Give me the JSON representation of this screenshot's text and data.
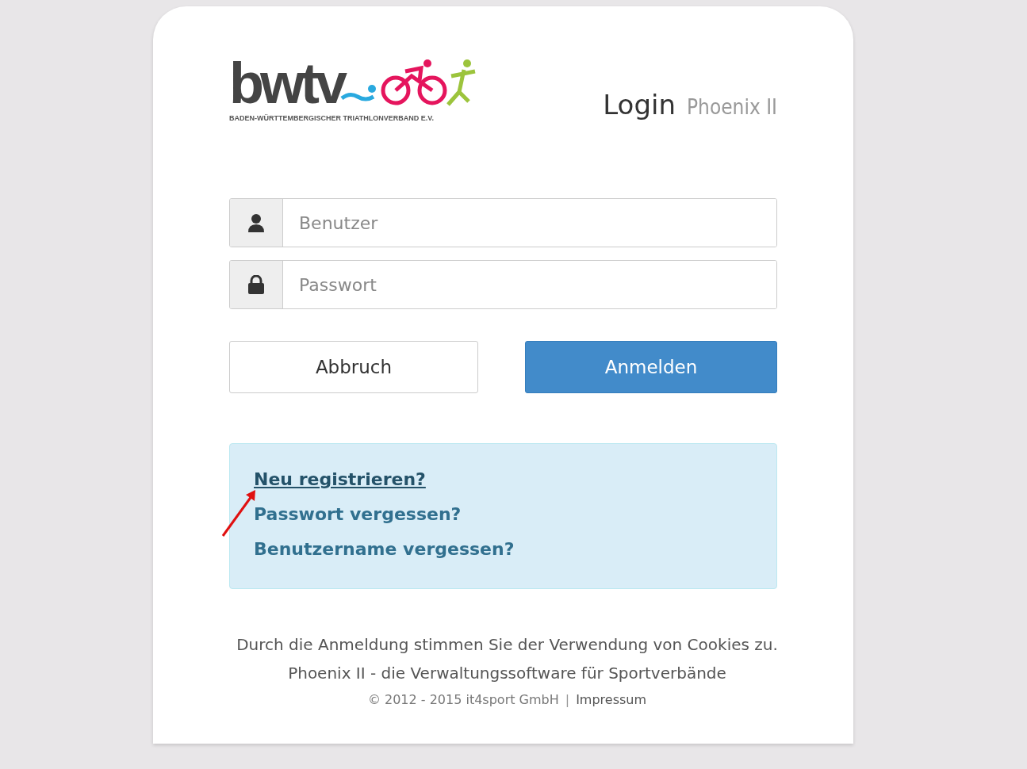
{
  "logo": {
    "wordmark": "bwtv",
    "tagline": "BADEN-WÜRTTEMBERGISCHER TRIATHLONVERBAND E.V."
  },
  "heading": {
    "title": "Login",
    "subtitle": "Phoenix II"
  },
  "fields": [
    {
      "kind": "user",
      "placeholder": "Benutzer"
    },
    {
      "kind": "password",
      "placeholder": "Passwort"
    }
  ],
  "buttons": [
    {
      "kind": "secondary",
      "label": "Abbruch"
    },
    {
      "kind": "primary",
      "label": "Anmelden"
    }
  ],
  "links": [
    {
      "label": "Neu registrieren?",
      "hovered": true
    },
    {
      "label": "Passwort vergessen?",
      "hovered": false
    },
    {
      "label": "Benutzername vergessen?",
      "hovered": false
    }
  ],
  "footer": {
    "notice": "Durch die Anmeldung stimmen Sie der Verwendung von Cookies zu.",
    "tagline": "Phoenix II - die Verwaltungssoftware für Sportverbände",
    "copyright": "© 2012 - 2015 it4sport GmbH",
    "separator": "|",
    "imprint": "Impressum"
  }
}
